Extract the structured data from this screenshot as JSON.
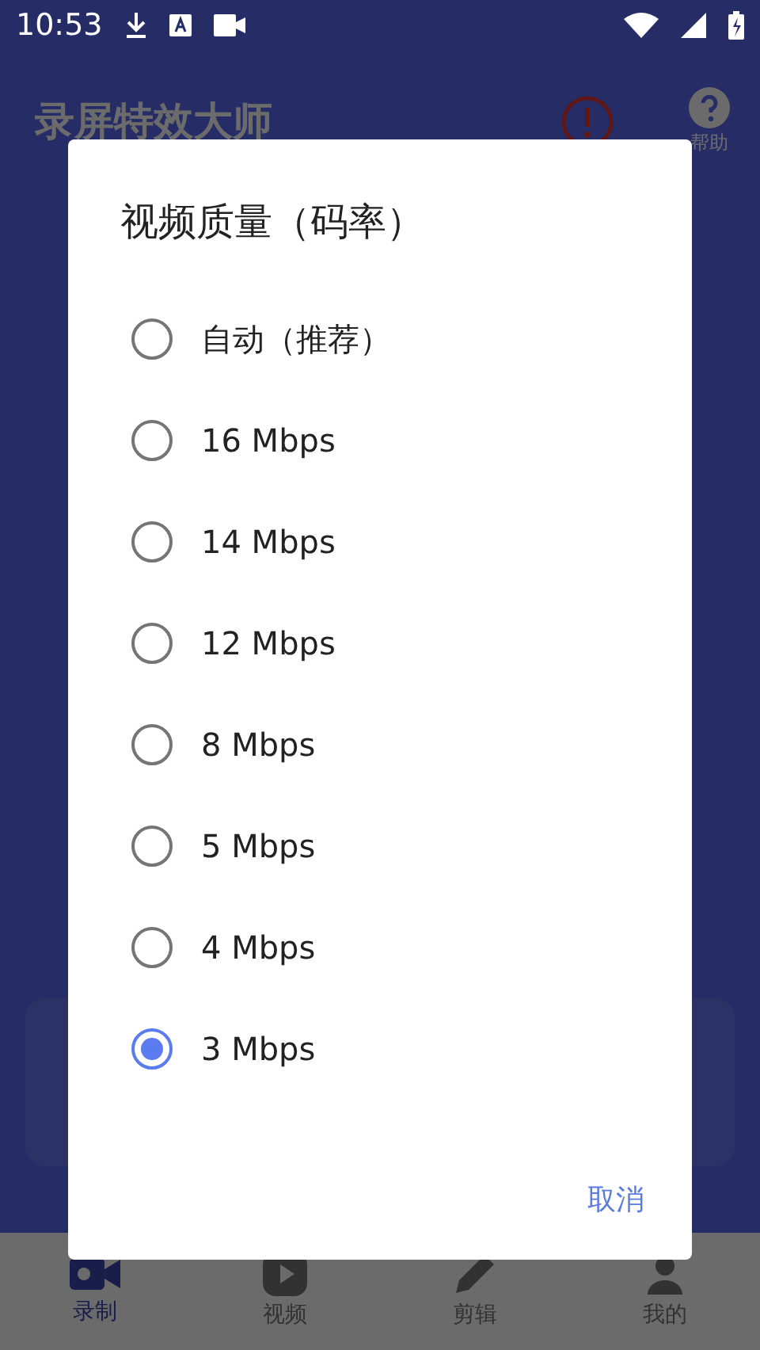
{
  "status_bar": {
    "time": "10:53"
  },
  "app_bar": {
    "title": "录屏特效大师",
    "help_label": "帮助"
  },
  "dialog": {
    "title": "视频质量（码率）",
    "options": [
      {
        "label": "自动（推荐）",
        "selected": false
      },
      {
        "label": "16 Mbps",
        "selected": false
      },
      {
        "label": "14 Mbps",
        "selected": false
      },
      {
        "label": "12 Mbps",
        "selected": false
      },
      {
        "label": "8 Mbps",
        "selected": false
      },
      {
        "label": "5 Mbps",
        "selected": false
      },
      {
        "label": "4 Mbps",
        "selected": false
      },
      {
        "label": "3 Mbps",
        "selected": true
      }
    ],
    "cancel_button": "取消"
  },
  "bottom_nav": [
    {
      "label": "录制",
      "kind": "record",
      "selected": true
    },
    {
      "label": "视频",
      "kind": "video",
      "selected": false
    },
    {
      "label": "剪辑",
      "kind": "edit",
      "selected": false
    },
    {
      "label": "我的",
      "kind": "profile",
      "selected": false
    }
  ]
}
